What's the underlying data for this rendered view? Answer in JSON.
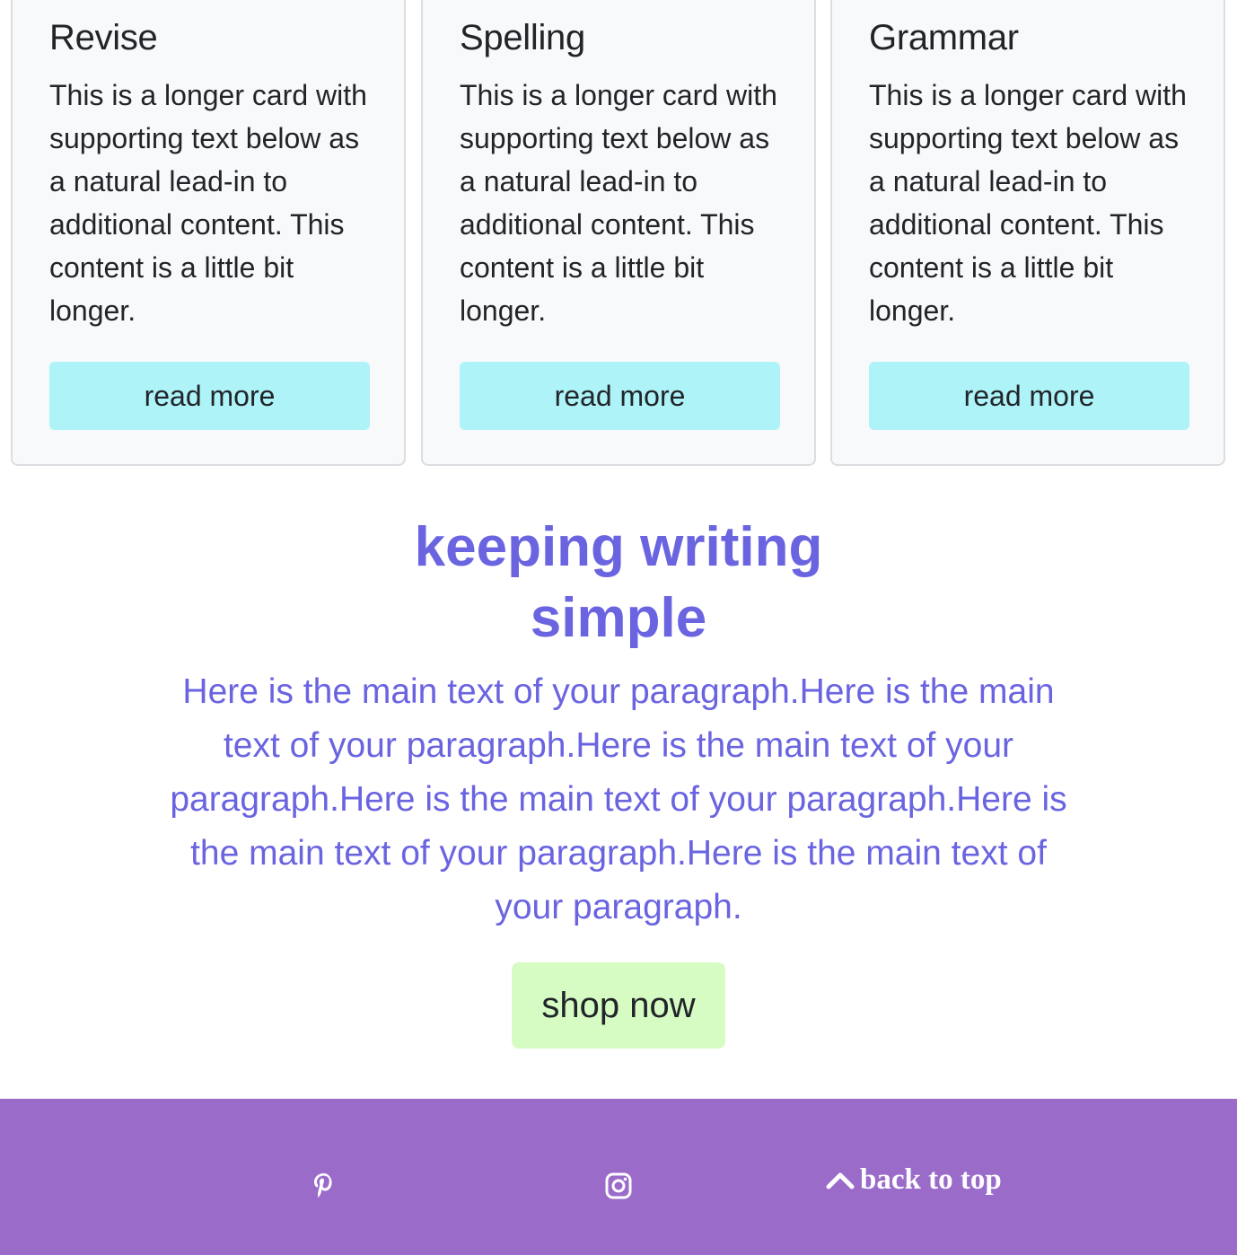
{
  "cards": [
    {
      "title": "Revise",
      "text": "This is a longer card with supporting text below as a natural lead-in to additional content. This content is a little bit longer.",
      "button": "read more"
    },
    {
      "title": "Spelling",
      "text": "This is a longer card with supporting text below as a natural lead-in to additional content. This content is a little bit longer.",
      "button": "read more"
    },
    {
      "title": "Grammar",
      "text": "This is a longer card with supporting text below as a natural lead-in to additional content. This content is a little bit longer.",
      "button": "read more"
    }
  ],
  "feature": {
    "headline_line1": "keeping writing",
    "headline_line2": "simple",
    "paragraph": "Here is the main text of your paragraph.Here is the main text of your paragraph.Here is the main text of your paragraph.Here is the main text of your paragraph.Here is the main text of your paragraph.Here is the main text of your paragraph.",
    "button": "shop now"
  },
  "footer": {
    "icons": [
      "pinterest-icon",
      "instagram-icon",
      "chevron-up-icon"
    ],
    "back_to_top": "back to top"
  },
  "colors": {
    "accent_text": "#6a64e0",
    "card_button": "#aef3f8",
    "shop_button": "#d6fcc4",
    "footer_bg": "#9b6bca"
  }
}
